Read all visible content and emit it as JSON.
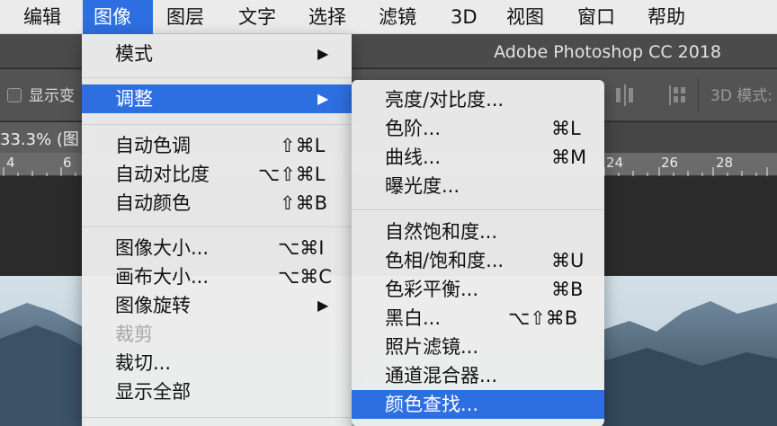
{
  "menubar": {
    "items": [
      "编辑",
      "图像",
      "图层",
      "文字",
      "选择",
      "滤镜",
      "3D",
      "视图",
      "窗口",
      "帮助"
    ],
    "active_index": 1
  },
  "app": {
    "title": "Adobe Photoshop CC 2018",
    "options": {
      "checkbox_label": "显示变",
      "mode_label": "3D 模式:"
    },
    "doc_tab": "33.3% (图",
    "ruler_labels": [
      "4",
      "6",
      "24",
      "26",
      "28"
    ]
  },
  "image_menu": {
    "mode": {
      "label": "模式",
      "arrow": "▶"
    },
    "adjust": {
      "label": "调整",
      "arrow": "▶"
    },
    "auto_tone": {
      "label": "自动色调",
      "shortcut": "⇧⌘L"
    },
    "auto_contrast": {
      "label": "自动对比度",
      "shortcut": "⌥⇧⌘L"
    },
    "auto_color": {
      "label": "自动颜色",
      "shortcut": "⇧⌘B"
    },
    "image_size": {
      "label": "图像大小...",
      "shortcut": "⌥⌘I"
    },
    "canvas_size": {
      "label": "画布大小...",
      "shortcut": "⌥⌘C"
    },
    "rotation": {
      "label": "图像旋转",
      "arrow": "▶"
    },
    "crop": {
      "label": "裁剪"
    },
    "trim": {
      "label": "裁切..."
    },
    "reveal_all": {
      "label": "显示全部"
    }
  },
  "adjust_menu": {
    "brightness": {
      "label": "亮度/对比度..."
    },
    "levels": {
      "label": "色阶...",
      "shortcut": "⌘L"
    },
    "curves": {
      "label": "曲线...",
      "shortcut": "⌘M"
    },
    "exposure": {
      "label": "曝光度..."
    },
    "vibrance": {
      "label": "自然饱和度..."
    },
    "hue_saturation": {
      "label": "色相/饱和度...",
      "shortcut": "⌘U"
    },
    "color_balance": {
      "label": "色彩平衡...",
      "shortcut": "⌘B"
    },
    "black_white": {
      "label": "黑白...",
      "shortcut": "⌥⇧⌘B"
    },
    "photo_filter": {
      "label": "照片滤镜..."
    },
    "channel_mixer": {
      "label": "通道混合器..."
    },
    "color_lookup": {
      "label": "颜色查找..."
    }
  },
  "colors": {
    "highlight": "#2d6fe0",
    "menu_bg": "#ececec",
    "sky": "#c9d8e2"
  }
}
